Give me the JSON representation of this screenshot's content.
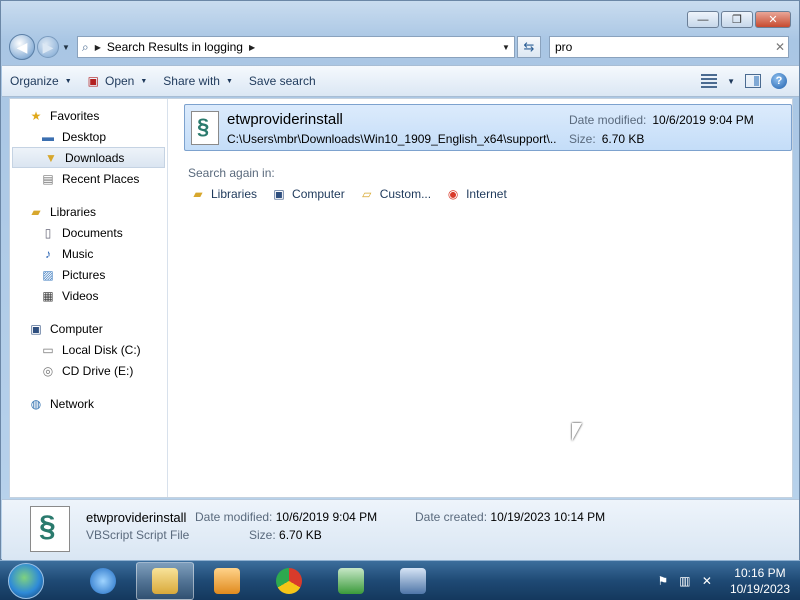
{
  "window": {
    "minimize_glyph": "—",
    "maximize_glyph": "❐",
    "close_glyph": "✕"
  },
  "address": {
    "path_label": "Search Results in logging",
    "search_value": "pro"
  },
  "toolbar": {
    "organize": "Organize",
    "open": "Open",
    "share_with": "Share with",
    "save_search": "Save search"
  },
  "nav": {
    "favorites": "Favorites",
    "desktop": "Desktop",
    "downloads": "Downloads",
    "recent_places": "Recent Places",
    "libraries": "Libraries",
    "documents": "Documents",
    "music": "Music",
    "pictures": "Pictures",
    "videos": "Videos",
    "computer": "Computer",
    "local_disk": "Local Disk (C:)",
    "cd_drive": "CD Drive (E:)",
    "network": "Network"
  },
  "result": {
    "name": "etwproviderinstall",
    "path": "C:\\Users\\mbr\\Downloads\\Win10_1909_English_x64\\support\\...",
    "date_modified_label": "Date modified:",
    "date_modified": "10/6/2019 9:04 PM",
    "size_label": "Size:",
    "size": "6.70 KB"
  },
  "search_again": {
    "label": "Search again in:",
    "items": [
      "Libraries",
      "Computer",
      "Custom...",
      "Internet"
    ]
  },
  "details": {
    "name": "etwproviderinstall",
    "type": "VBScript Script File",
    "date_modified_label": "Date modified:",
    "date_modified": "10/6/2019 9:04 PM",
    "size_label": "Size:",
    "size": "6.70 KB",
    "date_created_label": "Date created:",
    "date_created": "10/19/2023 10:14 PM"
  },
  "taskbar": {
    "time": "10:16 PM",
    "date": "10/19/2023"
  },
  "colors": {
    "accent": "#1e395b",
    "selection": "#c4ddf8"
  }
}
